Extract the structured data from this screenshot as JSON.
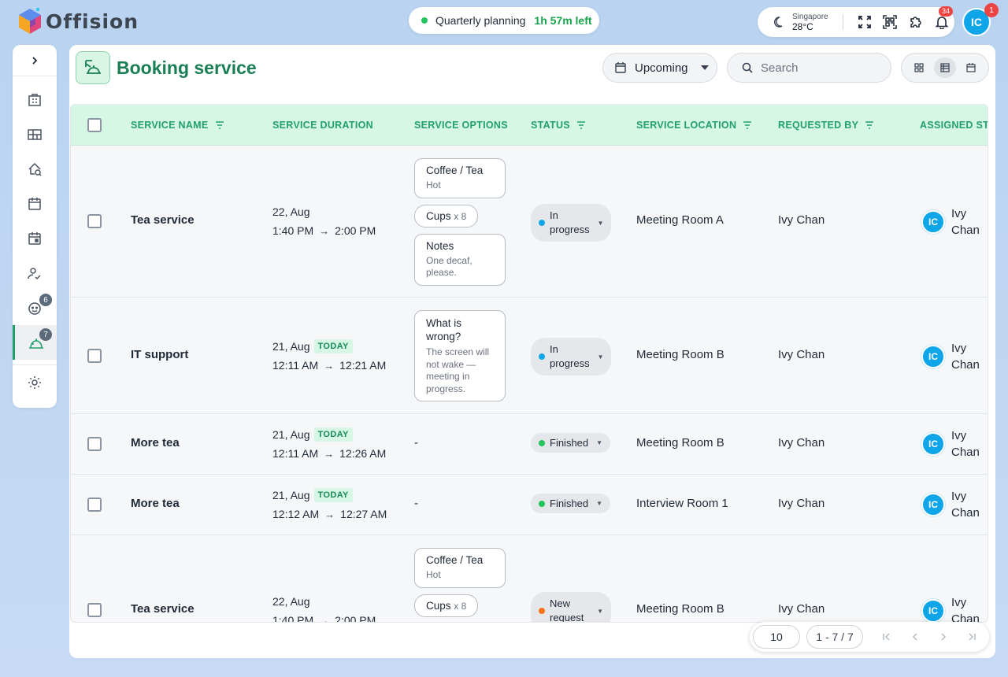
{
  "app": {
    "logo_text": "Offision"
  },
  "timer": {
    "title": "Quarterly planning",
    "time_left": "1h 57m left",
    "status_color": "#22c55e"
  },
  "weather": {
    "city": "Singapore",
    "temp": "28°C",
    "icon": "moon-icon"
  },
  "toolbar": {
    "notification_count": "34",
    "tools": [
      "fullscreen-icon",
      "qr-scan-icon",
      "extension-icon",
      "bell-icon"
    ]
  },
  "user": {
    "initials": "IC",
    "badge": "1"
  },
  "sidebar": {
    "items": [
      {
        "icon": "building-icon",
        "badge": null
      },
      {
        "icon": "floorplan-icon",
        "badge": null
      },
      {
        "icon": "find-seat-icon",
        "badge": null
      },
      {
        "icon": "calendar-icon",
        "badge": null
      },
      {
        "icon": "calendar-event-icon",
        "badge": null
      },
      {
        "icon": "visitor-check-icon",
        "badge": null
      },
      {
        "icon": "face-icon",
        "badge": "6"
      },
      {
        "icon": "service-bell-icon",
        "badge": "7"
      }
    ],
    "settings_icon": "gear-icon"
  },
  "page": {
    "title": "Booking service",
    "filter_label": "Upcoming",
    "search_placeholder": "Search",
    "accent": "#1b7f55"
  },
  "table": {
    "headers": {
      "service_name": "SERVICE NAME",
      "service_duration": "SERVICE DURATION",
      "service_options": "SERVICE OPTIONS",
      "status": "STATUS",
      "service_location": "SERVICE LOCATION",
      "requested_by": "REQUESTED BY",
      "assigned_staff": "ASSIGNED STAFF"
    },
    "rows": [
      {
        "name": "Tea service",
        "date": "22, Aug",
        "today": "",
        "start": "1:40 PM",
        "end": "2:00 PM",
        "options": [
          {
            "title": "Coffee / Tea",
            "sub": "Hot"
          },
          {
            "title": "Cups",
            "qty": "x 8"
          },
          {
            "title": "Notes",
            "sub": "One decaf, please."
          }
        ],
        "status": "In progress",
        "status_color": "#0ea5e9",
        "location": "Meeting Room A",
        "requested_by": "Ivy Chan",
        "staff_initials": "IC",
        "staff_name": "Ivy Chan"
      },
      {
        "name": "IT support",
        "date": "21, Aug",
        "today": "TODAY",
        "start": "12:11 AM",
        "end": "12:21 AM",
        "options": [
          {
            "title": "What is wrong?",
            "sub": "The screen will not wake — meeting in progress."
          }
        ],
        "status": "In progress",
        "status_color": "#0ea5e9",
        "location": "Meeting Room B",
        "requested_by": "Ivy Chan",
        "staff_initials": "IC",
        "staff_name": "Ivy Chan"
      },
      {
        "name": "More tea",
        "date": "21, Aug",
        "today": "TODAY",
        "start": "12:11 AM",
        "end": "12:26 AM",
        "options_text": "-",
        "status": "Finished",
        "status_color": "#22c55e",
        "location": "Meeting Room B",
        "requested_by": "Ivy Chan",
        "staff_initials": "IC",
        "staff_name": "Ivy Chan"
      },
      {
        "name": "More tea",
        "date": "21, Aug",
        "today": "TODAY",
        "start": "12:12 AM",
        "end": "12:27 AM",
        "options_text": "-",
        "status": "Finished",
        "status_color": "#22c55e",
        "location": "Interview Room 1",
        "requested_by": "Ivy Chan",
        "staff_initials": "IC",
        "staff_name": "Ivy Chan"
      },
      {
        "name": "Tea service",
        "date": "22, Aug",
        "today": "",
        "start": "1:40 PM",
        "end": "2:00 PM",
        "options": [
          {
            "title": "Coffee / Tea",
            "sub": "Hot"
          },
          {
            "title": "Cups",
            "qty": "x 8"
          }
        ],
        "status": "New request",
        "status_color": "#f97316",
        "location": "Meeting Room B",
        "requested_by": "Ivy Chan",
        "staff_initials": "IC",
        "staff_name": "Ivy Chan"
      }
    ]
  },
  "pagination": {
    "page_size": "10",
    "range": "1 - 7 / 7"
  }
}
